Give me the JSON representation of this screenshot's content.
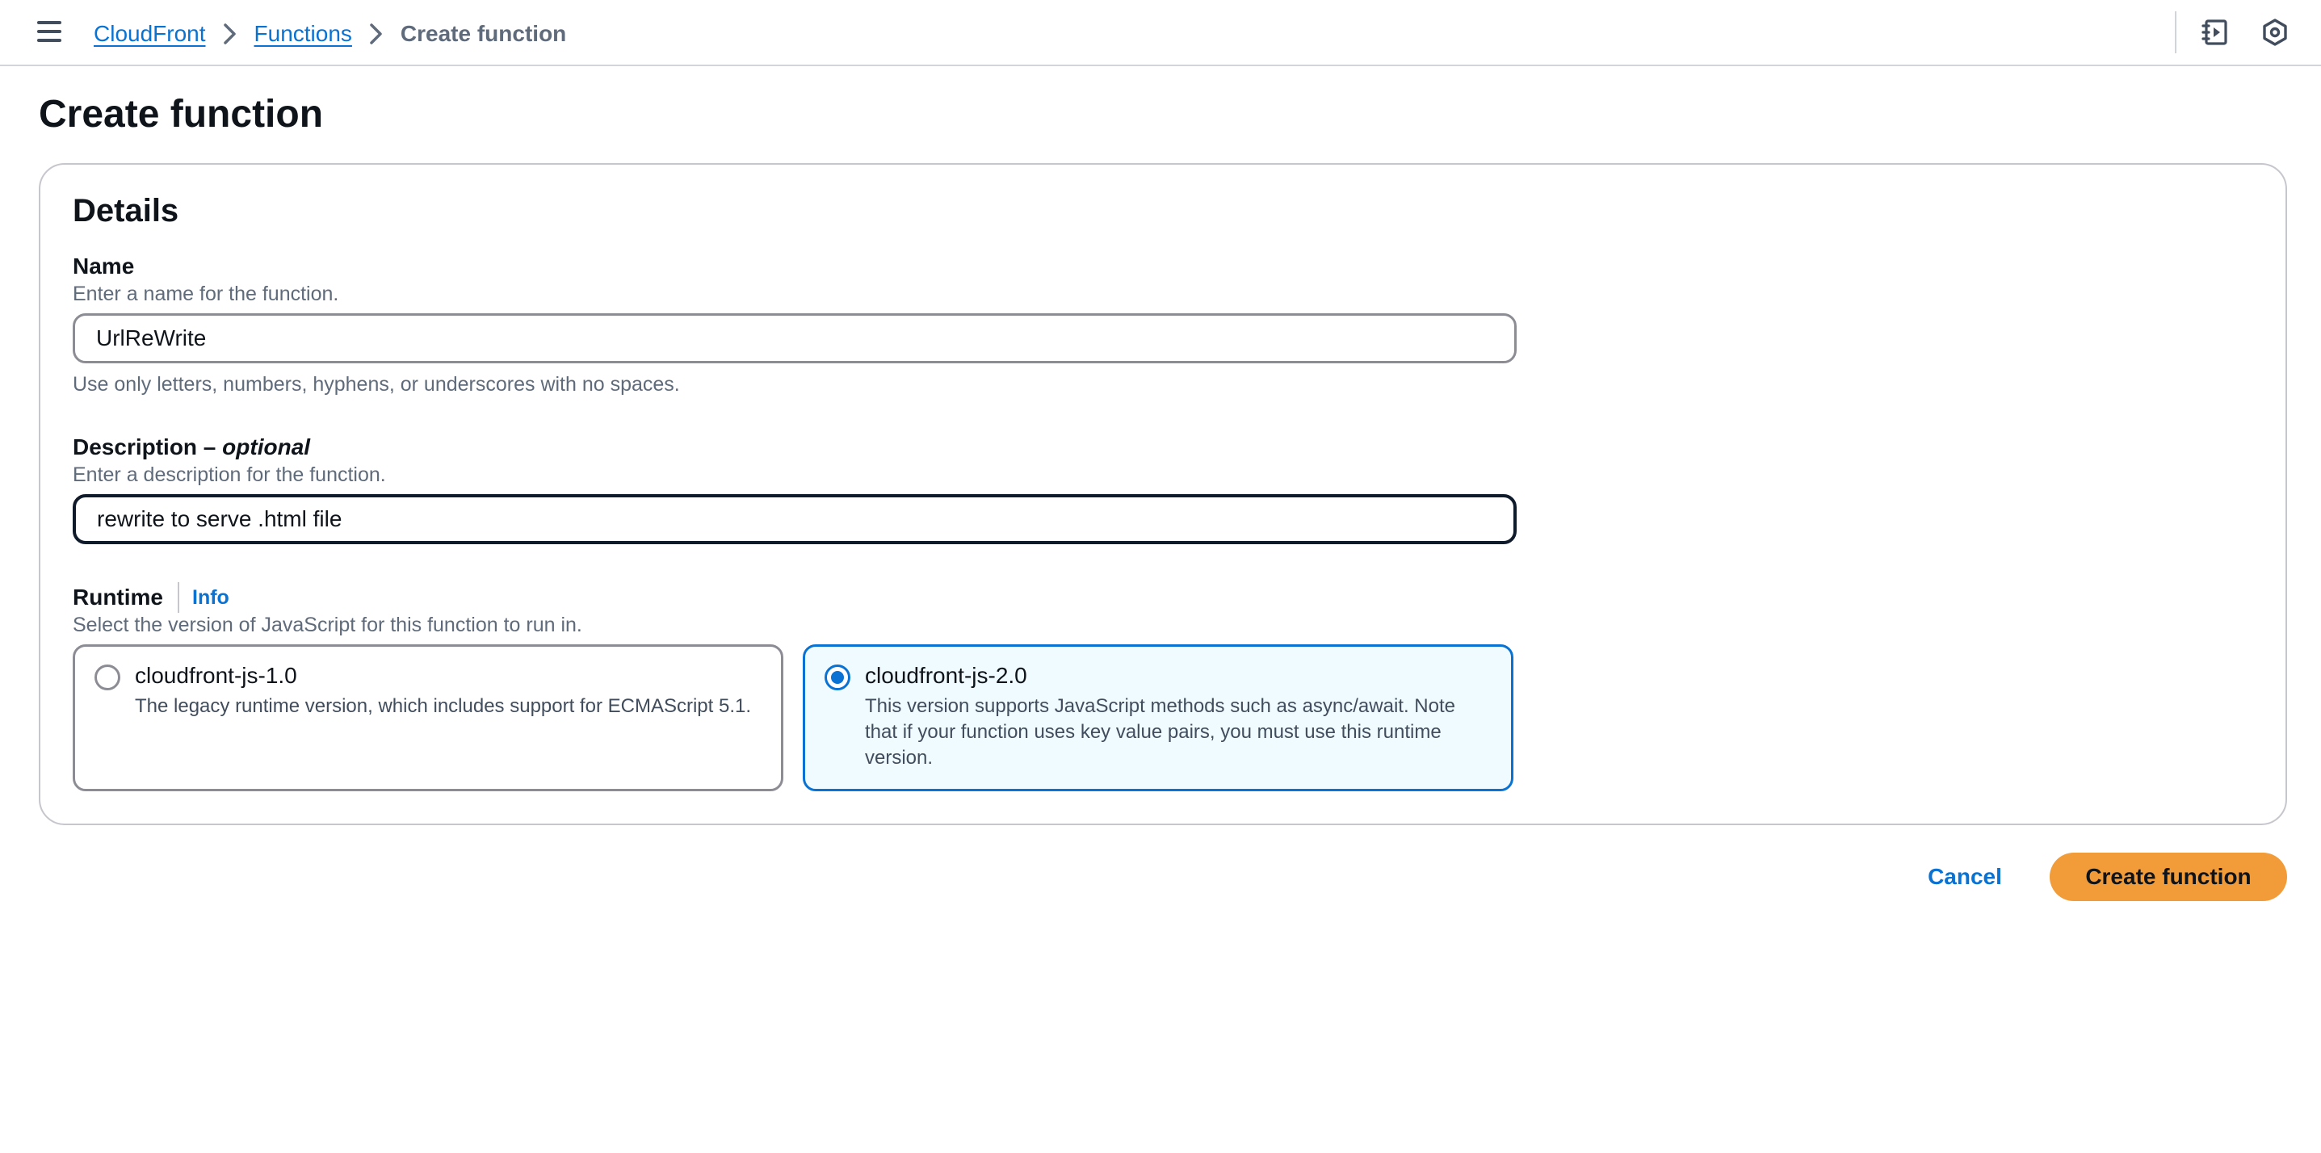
{
  "header": {
    "breadcrumbs": [
      "CloudFront",
      "Functions",
      "Create function"
    ]
  },
  "page": {
    "title": "Create function"
  },
  "details": {
    "title": "Details",
    "name": {
      "label": "Name",
      "description": "Enter a name for the function.",
      "value": "UrlReWrite",
      "constraint": "Use only letters, numbers, hyphens, or underscores with no spaces."
    },
    "description": {
      "label": "Description",
      "dash": " – ",
      "optional": "optional",
      "description": "Enter a description for the function.",
      "value": "rewrite to serve .html file"
    },
    "runtime": {
      "label": "Runtime",
      "info": "Info",
      "description": "Select the version of JavaScript for this function to run in.",
      "options": [
        {
          "title": "cloudfront-js-1.0",
          "description": "The legacy runtime version, which includes support for ECMAScript 5.1.",
          "selected": false
        },
        {
          "title": "cloudfront-js-2.0",
          "description": "This version supports JavaScript methods such as async/await. Note that if your function uses key value pairs, you must use this runtime version.",
          "selected": true
        }
      ]
    }
  },
  "actions": {
    "cancel": "Cancel",
    "create": "Create function"
  },
  "colors": {
    "link": "#0972d3",
    "primary_button": "#f29b39",
    "selected_card_bg": "#f0fbff"
  },
  "icons": {
    "menu": "hamburger-menu-icon",
    "breadcrumb_separator": "chevron-right-icon",
    "notebook": "notebook-play-icon",
    "settings": "hexagon-settings-icon"
  }
}
